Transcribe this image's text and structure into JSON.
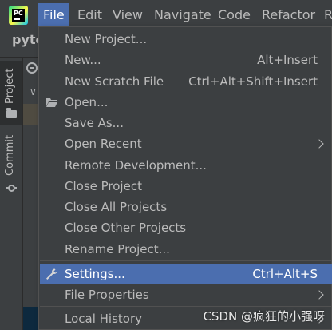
{
  "menubar": {
    "items": [
      {
        "label": "File",
        "active": true
      },
      {
        "label": "Edit"
      },
      {
        "label": "View"
      },
      {
        "label": "Navigate"
      },
      {
        "label": "Code"
      },
      {
        "label": "Refactor"
      },
      {
        "label": "R"
      }
    ]
  },
  "project": {
    "name_fragment": "pyto"
  },
  "tool_strip": {
    "project_tab": "Project",
    "commit_tab": "Commit"
  },
  "file_menu": {
    "items": [
      {
        "label": "New Project...",
        "shortcut": ""
      },
      {
        "label": "New...",
        "shortcut": "Alt+Insert"
      },
      {
        "label": "New Scratch File",
        "shortcut": "Ctrl+Alt+Shift+Insert"
      },
      {
        "label": "Open...",
        "shortcut": "",
        "icon": "folder-open-icon"
      },
      {
        "label": "Save As...",
        "shortcut": ""
      },
      {
        "label": "Open Recent",
        "shortcut": "",
        "submenu": true
      },
      {
        "label": "Remote Development...",
        "shortcut": ""
      },
      {
        "label": "Close Project",
        "shortcut": ""
      },
      {
        "label": "Close All Projects",
        "shortcut": ""
      },
      {
        "label": "Close Other Projects",
        "shortcut": ""
      },
      {
        "label": "Rename Project...",
        "shortcut": ""
      },
      {
        "label": "Settings...",
        "shortcut": "Ctrl+Alt+S",
        "icon": "wrench-icon",
        "selected": true
      },
      {
        "label": "File Properties",
        "shortcut": "",
        "submenu": true
      },
      {
        "label": "Local History",
        "shortcut": "",
        "submenu": true
      }
    ]
  },
  "watermark": "CSDN @疯狂的小强呀",
  "colors": {
    "accent": "#4b6eaf",
    "background": "#3c3f41",
    "text": "#bbbbbb"
  }
}
